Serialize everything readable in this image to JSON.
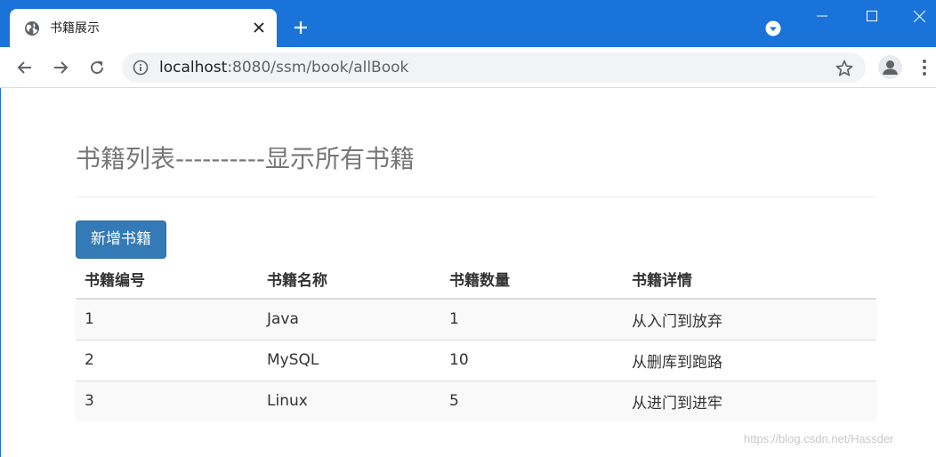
{
  "browser": {
    "tab_title": "书籍展示",
    "url_host": "localhost",
    "url_path": ":8080/ssm/book/allBook",
    "colors": {
      "frame": "#1a73d9",
      "omnibox": "#f1f3f4"
    }
  },
  "page": {
    "title": "书籍列表----------显示所有书籍",
    "add_button_label": "新增书籍",
    "table": {
      "headers": [
        "书籍编号",
        "书籍名称",
        "书籍数量",
        "书籍详情"
      ],
      "rows": [
        [
          "1",
          "Java",
          "1",
          "从入门到放弃"
        ],
        [
          "2",
          "MySQL",
          "10",
          "从删库到跑路"
        ],
        [
          "3",
          "Linux",
          "5",
          "从进门到进牢"
        ]
      ]
    },
    "colors": {
      "primary_button": "#337ab7",
      "title_text": "#777777"
    }
  },
  "watermark": "https://blog.csdn.net/Hassder"
}
